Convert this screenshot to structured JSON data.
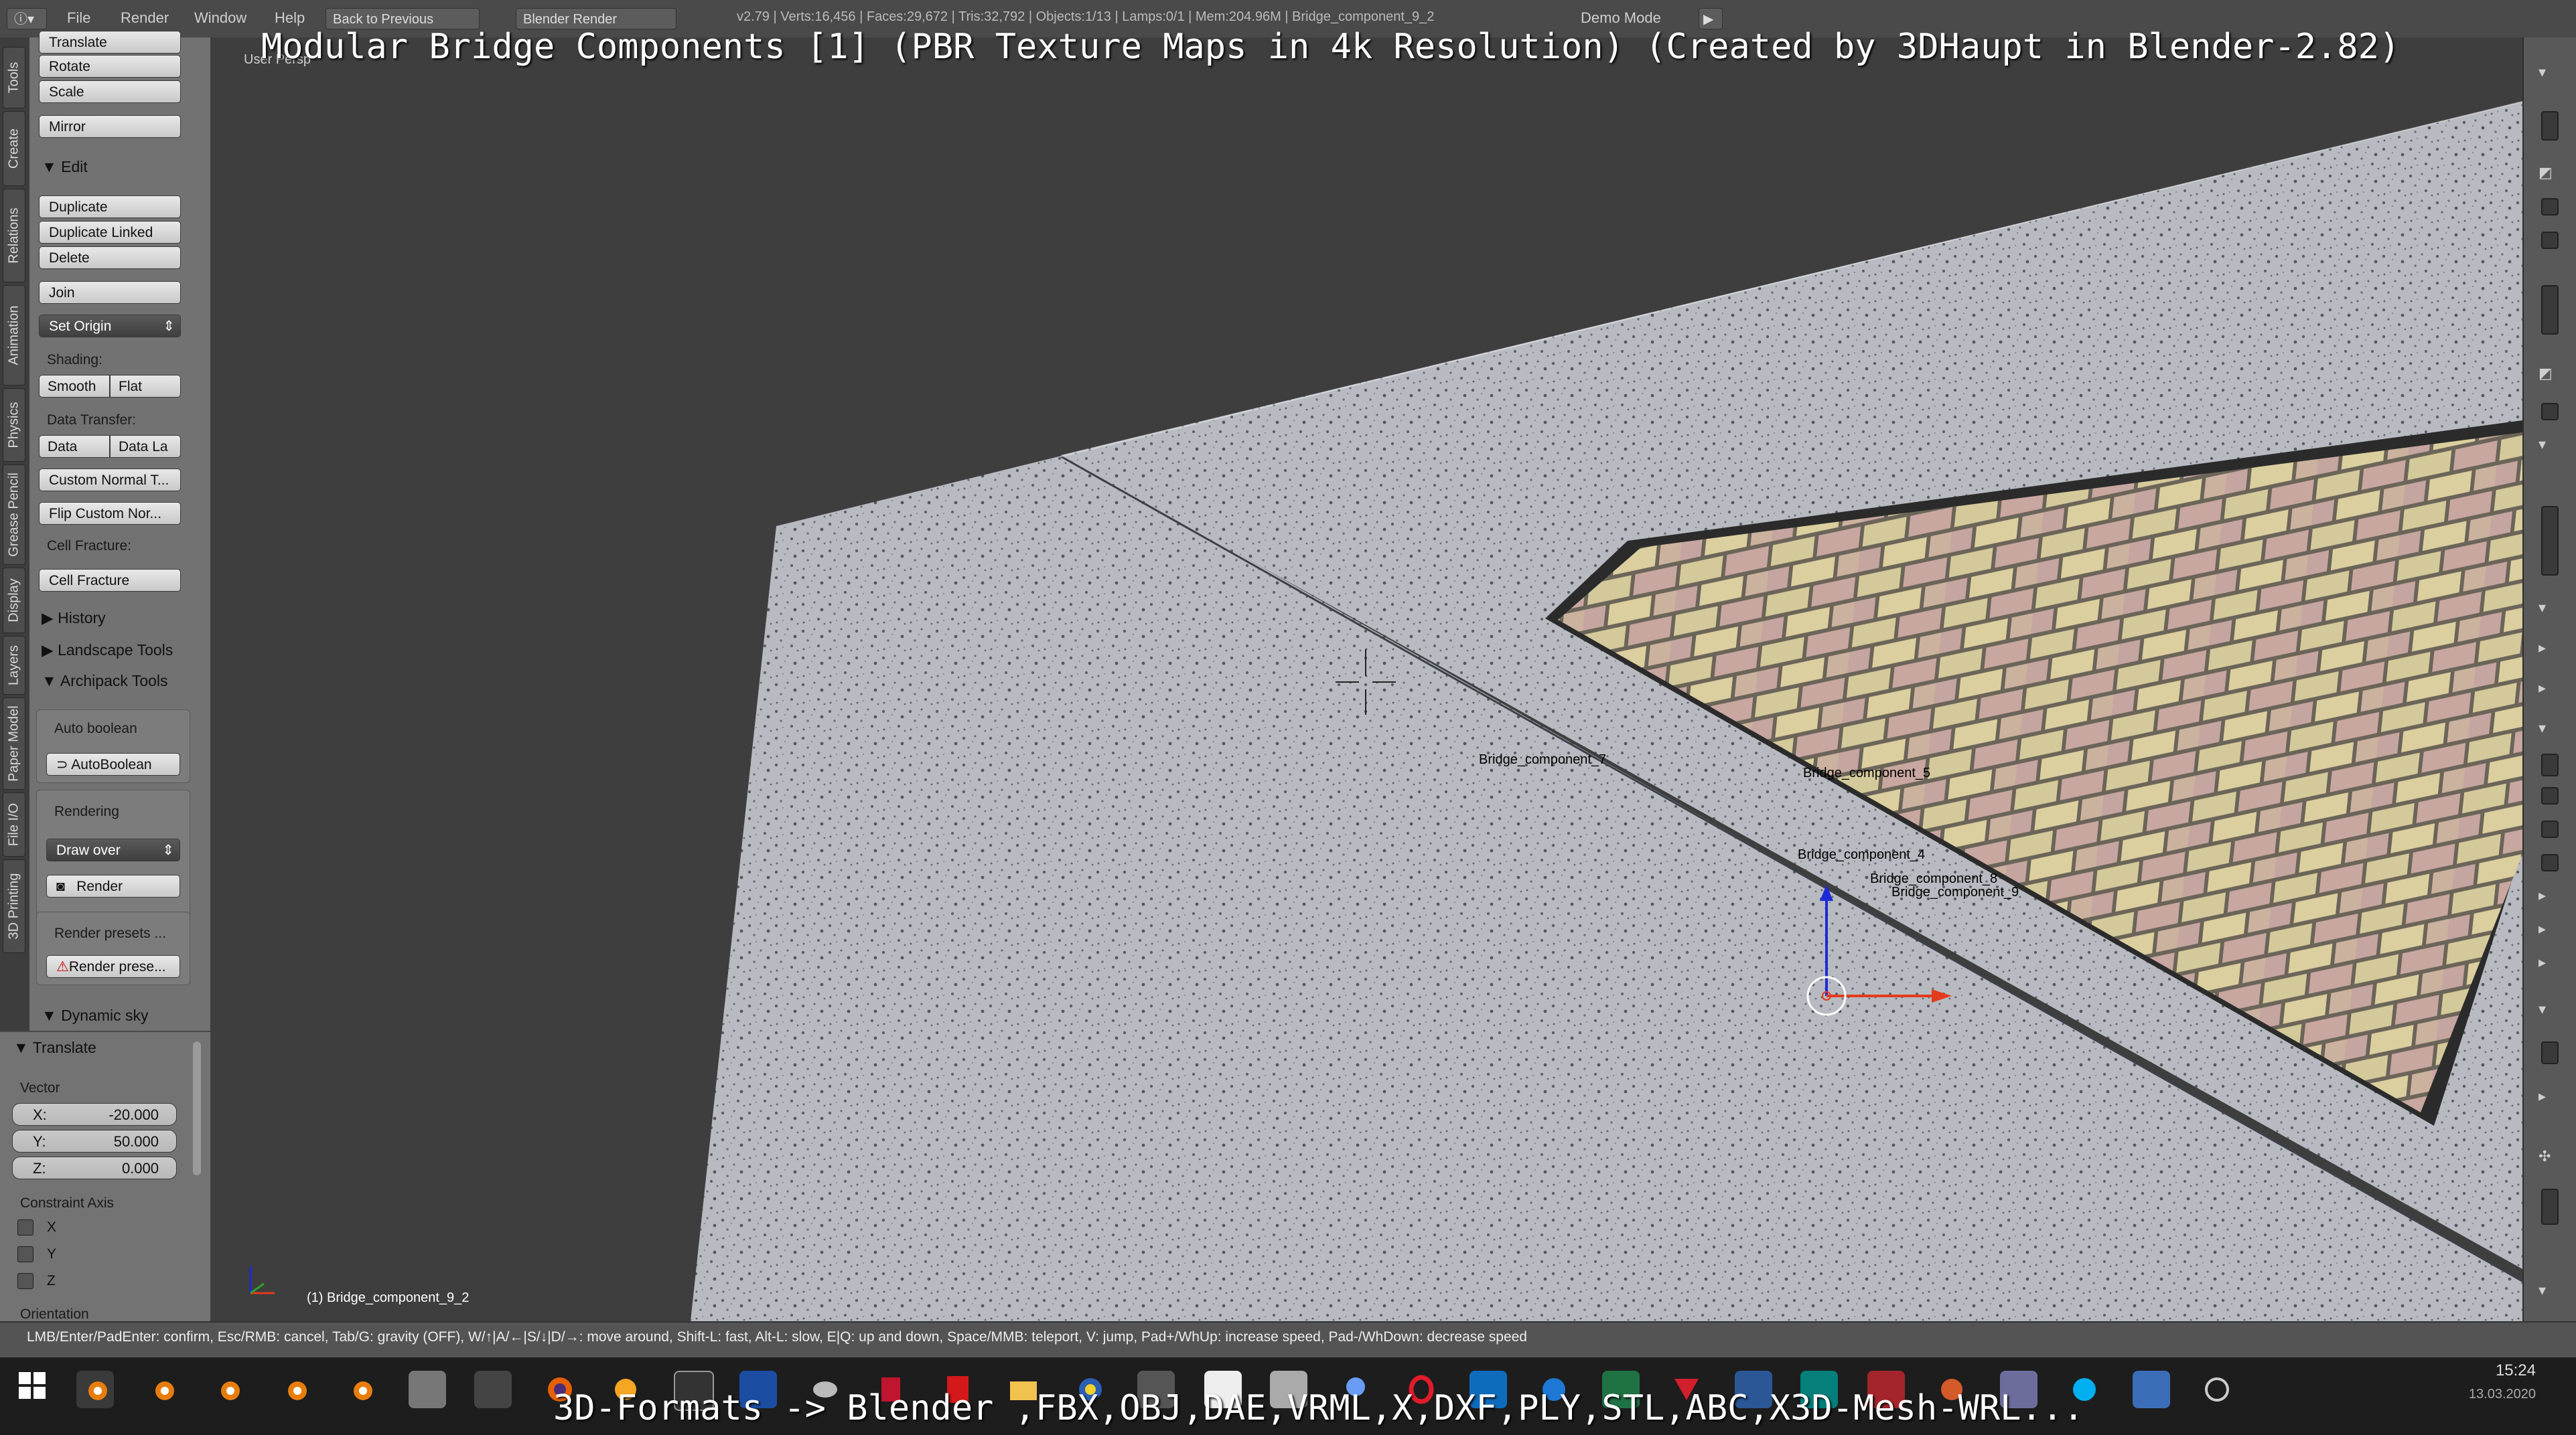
{
  "menubar": {
    "items": [
      "File",
      "Render",
      "Window",
      "Help"
    ],
    "back_button": "Back to Previous",
    "engine": "Blender Render",
    "stats": "v2.79 | Verts:16,456 | Faces:29,672 | Tris:32,792 | Objects:1/13 | Lamps:0/1 | Mem:204.96M | Bridge_component_9_2",
    "demo_mode": "Demo Mode"
  },
  "overlay": {
    "title": "Modular Bridge Components [1] (PBR Texture Maps in 4k Resolution) (Created by 3DHaupt in Blender-2.82)",
    "bottom": "3D-Formats -> Blender ,FBX,OBJ,DAE,VRML,X,DXF,PLY,STL,ABC,X3D-Mesh-WRL..."
  },
  "vertical_tabs": [
    "Tools",
    "Create",
    "Relations",
    "Animation",
    "Physics",
    "Grease Pencil",
    "Display",
    "Layers",
    "Paper Model",
    "File I/O",
    "3D Printing"
  ],
  "toolshelf": {
    "translate": "Translate",
    "rotate": "Rotate",
    "scale": "Scale",
    "mirror": "Mirror",
    "edit_header": "Edit",
    "duplicate": "Duplicate",
    "duplicate_linked": "Duplicate Linked",
    "delete": "Delete",
    "join": "Join",
    "set_origin": "Set Origin",
    "shading_label": "Shading:",
    "smooth": "Smooth",
    "flat": "Flat",
    "data_transfer_label": "Data Transfer:",
    "data": "Data",
    "data_la": "Data La",
    "custom_normal": "Custom Normal T...",
    "flip_custom": "Flip Custom Nor...",
    "cell_fracture_label": "Cell Fracture:",
    "cell_fracture": "Cell Fracture",
    "history": "History",
    "landscape_tools": "Landscape Tools",
    "archipack_tools": "Archipack Tools",
    "auto_boolean_label": "Auto boolean",
    "autoboolean": "AutoBoolean",
    "rendering_label": "Rendering",
    "draw_over": "Draw over",
    "render": "Render",
    "render_presets_label": "Render presets ...",
    "render_presets_btn": "Render prese...",
    "dynamic_sky": "Dynamic sky"
  },
  "operator": {
    "header": "Translate",
    "vector_label": "Vector",
    "x_label": "X:",
    "x_value": "-20.000",
    "y_label": "Y:",
    "y_value": "50.000",
    "z_label": "Z:",
    "z_value": "0.000",
    "constraint_label": "Constraint Axis",
    "cx": "X",
    "cy": "Y",
    "cz": "Z",
    "orientation": "Orientation"
  },
  "viewport": {
    "view_name": "User Persp",
    "active_object": "(1) Bridge_component_9_2",
    "labels": [
      "Bridge_component_7",
      "Bridge_component_5",
      "Bridge_component_4",
      "Bridge_component_8",
      "Bridge_component_9"
    ]
  },
  "statusbar": {
    "text": "LMB/Enter/PadEnter: confirm, Esc/RMB: cancel, Tab/G: gravity (OFF), W/↑|A/←|S/↓|D/→: move around, Shift-L: fast, Alt-L: slow, E|Q: up and down, Space/MMB: teleport, V: jump, Pad+/WhUp: increase speed, Pad-/WhDown: decrease speed"
  },
  "taskbar": {
    "time": "15:24",
    "date": "13.03.2020"
  },
  "colors": {
    "concrete": "#b9bcc1",
    "brick_light": "#d9cfa0",
    "brick_pink": "#c9a9a3",
    "axis_x": "#e23b1e",
    "axis_y": "#1c2bd8"
  }
}
